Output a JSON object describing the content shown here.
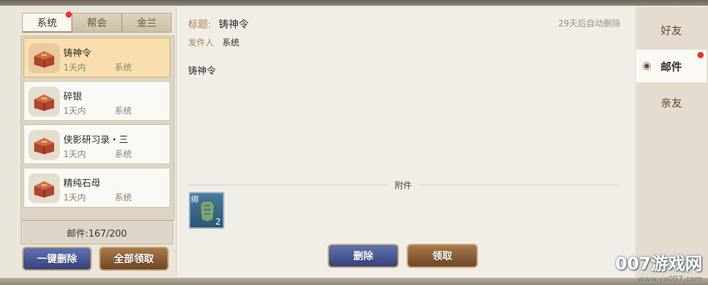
{
  "tabs": [
    {
      "label": "系统",
      "active": true,
      "has_dot": true
    },
    {
      "label": "帮会",
      "active": false
    },
    {
      "label": "金兰",
      "active": false
    }
  ],
  "mail_list": [
    {
      "title": "铸神令",
      "time": "1天内",
      "source": "系统",
      "selected": true
    },
    {
      "title": "碎银",
      "time": "1天内",
      "source": "系统",
      "selected": false
    },
    {
      "title": "侠影研习录・三",
      "time": "1天内",
      "source": "系统",
      "selected": false
    },
    {
      "title": "精纯石母",
      "time": "1天内",
      "source": "系统",
      "selected": false
    }
  ],
  "mail_count": "邮件:167/200",
  "buttons": {
    "delete_all": "一键删除",
    "claim_all": "全部领取",
    "delete": "删除",
    "claim": "领取"
  },
  "detail": {
    "subject_label": "标题:",
    "subject": "铸神令",
    "expire_note": "29天后自动删除",
    "sender_label": "发件人",
    "sender": "系统",
    "body": "铸神令",
    "attachment_label": "附件",
    "attachment": {
      "tag": "绑",
      "quantity": "2",
      "icon": "jade-token-icon"
    }
  },
  "right_nav": [
    {
      "label": "好友",
      "active": false
    },
    {
      "label": "邮件",
      "active": true,
      "has_dot": true
    },
    {
      "label": "亲友",
      "active": false
    }
  ],
  "watermark": {
    "main": "007游戏网",
    "sub": "www.yx007.com"
  },
  "colors": {
    "selected_item": "#f9dfae",
    "blue_button": "#3f4f90",
    "brown_button": "#8a5a33",
    "notify_dot": "#e23a2c"
  }
}
